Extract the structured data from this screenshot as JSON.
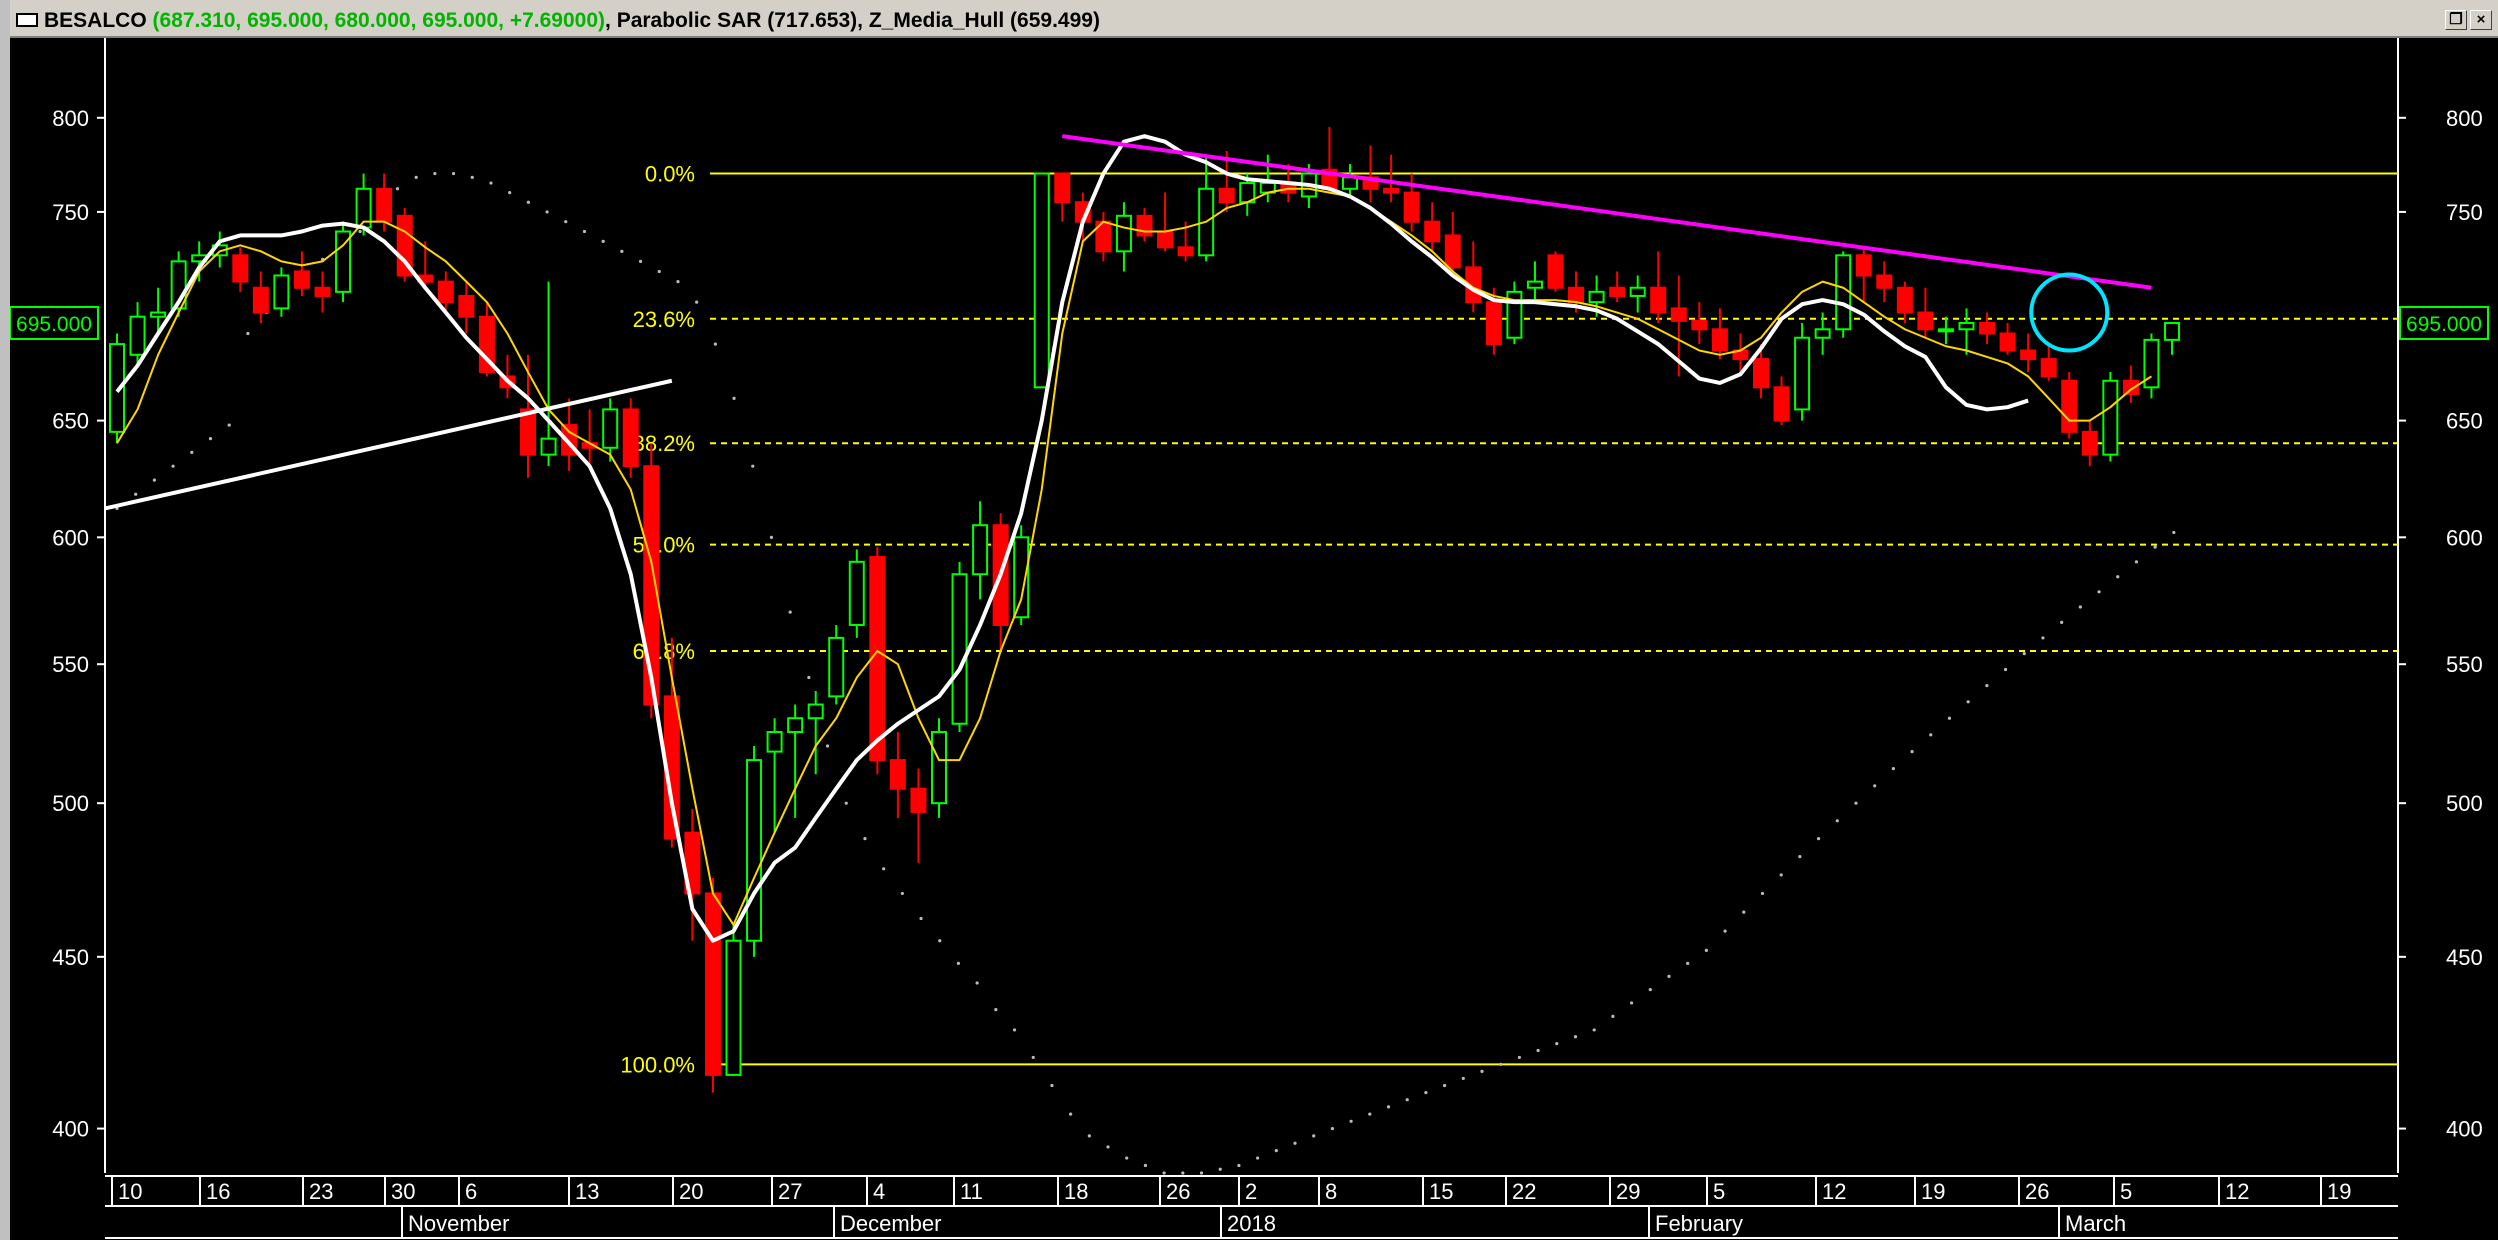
{
  "window": {
    "symbol": "BESALCO",
    "ohlc": "(687.310, 695.000, 680.000, 695.000, +7.69000)",
    "indicator1": "Parabolic SAR",
    "indicator1_value": "(717.653)",
    "indicator2": "Z_Media_Hull",
    "indicator2_value": "(659.499)",
    "restore_button": "❐",
    "close_button": "×"
  },
  "colors": {
    "background": "#000000",
    "up_candle": "#00ff00",
    "down_candle": "#ff0000",
    "hull_ma": "#ffffff",
    "fast_ma": "#ffd700",
    "fibonacci": "#ffff00",
    "resistance_line": "#ff00ff",
    "support_line": "#ffffff",
    "highlight_circle": "#00e5ff",
    "sar_dots": "#bbbbbb",
    "last_price_label": "#00ff00"
  },
  "chart_data": {
    "type": "candlestick",
    "y_scale": "log",
    "ylim": [
      388,
      845
    ],
    "y_ticks": [
      400,
      450,
      500,
      550,
      600,
      650,
      750,
      800
    ],
    "last_price_label": "695.000",
    "x_day_labels": [
      "10",
      "16",
      "23",
      "30",
      "6",
      "13",
      "20",
      "27",
      "4",
      "11",
      "18",
      "26",
      "2",
      "8",
      "15",
      "22",
      "29",
      "5",
      "12",
      "19",
      "26",
      "5",
      "12",
      "19"
    ],
    "x_month_labels": [
      "November",
      "December",
      "2018",
      "February",
      "March"
    ],
    "candles": [
      {
        "o": 645,
        "h": 690,
        "l": 640,
        "c": 685
      },
      {
        "o": 680,
        "h": 705,
        "l": 675,
        "c": 698
      },
      {
        "o": 698,
        "h": 712,
        "l": 690,
        "c": 700
      },
      {
        "o": 702,
        "h": 730,
        "l": 698,
        "c": 725
      },
      {
        "o": 725,
        "h": 735,
        "l": 715,
        "c": 728
      },
      {
        "o": 728,
        "h": 740,
        "l": 722,
        "c": 733
      },
      {
        "o": 728,
        "h": 732,
        "l": 710,
        "c": 715
      },
      {
        "o": 712,
        "h": 720,
        "l": 695,
        "c": 700
      },
      {
        "o": 702,
        "h": 722,
        "l": 698,
        "c": 718
      },
      {
        "o": 720,
        "h": 730,
        "l": 708,
        "c": 712
      },
      {
        "o": 712,
        "h": 720,
        "l": 700,
        "c": 708
      },
      {
        "o": 710,
        "h": 745,
        "l": 705,
        "c": 740
      },
      {
        "o": 742,
        "h": 770,
        "l": 738,
        "c": 762
      },
      {
        "o": 762,
        "h": 770,
        "l": 740,
        "c": 745
      },
      {
        "o": 748,
        "h": 752,
        "l": 715,
        "c": 718
      },
      {
        "o": 718,
        "h": 735,
        "l": 712,
        "c": 715
      },
      {
        "o": 715,
        "h": 720,
        "l": 700,
        "c": 705
      },
      {
        "o": 708,
        "h": 715,
        "l": 690,
        "c": 698
      },
      {
        "o": 698,
        "h": 705,
        "l": 670,
        "c": 672
      },
      {
        "o": 670,
        "h": 680,
        "l": 660,
        "c": 665
      },
      {
        "o": 655,
        "h": 680,
        "l": 625,
        "c": 635
      },
      {
        "o": 635,
        "h": 715,
        "l": 630,
        "c": 642
      },
      {
        "o": 648,
        "h": 660,
        "l": 628,
        "c": 635
      },
      {
        "o": 640,
        "h": 655,
        "l": 630,
        "c": 638
      },
      {
        "o": 638,
        "h": 660,
        "l": 632,
        "c": 655
      },
      {
        "o": 655,
        "h": 660,
        "l": 625,
        "c": 630
      },
      {
        "o": 630,
        "h": 640,
        "l": 530,
        "c": 535
      },
      {
        "o": 538,
        "h": 560,
        "l": 485,
        "c": 488
      },
      {
        "o": 490,
        "h": 498,
        "l": 455,
        "c": 470
      },
      {
        "o": 470,
        "h": 475,
        "l": 410,
        "c": 415
      },
      {
        "o": 415,
        "h": 460,
        "l": 415,
        "c": 455
      },
      {
        "o": 455,
        "h": 520,
        "l": 450,
        "c": 515
      },
      {
        "o": 518,
        "h": 530,
        "l": 490,
        "c": 525
      },
      {
        "o": 525,
        "h": 535,
        "l": 495,
        "c": 530
      },
      {
        "o": 530,
        "h": 540,
        "l": 510,
        "c": 535
      },
      {
        "o": 538,
        "h": 565,
        "l": 535,
        "c": 560
      },
      {
        "o": 565,
        "h": 595,
        "l": 560,
        "c": 590
      },
      {
        "o": 592,
        "h": 596,
        "l": 510,
        "c": 515
      },
      {
        "o": 515,
        "h": 525,
        "l": 495,
        "c": 505
      },
      {
        "o": 505,
        "h": 512,
        "l": 480,
        "c": 497
      },
      {
        "o": 500,
        "h": 530,
        "l": 495,
        "c": 525
      },
      {
        "o": 528,
        "h": 590,
        "l": 525,
        "c": 585
      },
      {
        "o": 585,
        "h": 615,
        "l": 575,
        "c": 605
      },
      {
        "o": 605,
        "h": 610,
        "l": 555,
        "c": 565
      },
      {
        "o": 568,
        "h": 605,
        "l": 565,
        "c": 600
      },
      {
        "o": 665,
        "h": 770,
        "l": 665,
        "c": 770
      },
      {
        "o": 770,
        "h": 770,
        "l": 745,
        "c": 755
      },
      {
        "o": 755,
        "h": 760,
        "l": 735,
        "c": 745
      },
      {
        "o": 745,
        "h": 750,
        "l": 725,
        "c": 730
      },
      {
        "o": 730,
        "h": 755,
        "l": 720,
        "c": 748
      },
      {
        "o": 748,
        "h": 752,
        "l": 735,
        "c": 738
      },
      {
        "o": 740,
        "h": 760,
        "l": 730,
        "c": 732
      },
      {
        "o": 732,
        "h": 745,
        "l": 725,
        "c": 728
      },
      {
        "o": 728,
        "h": 780,
        "l": 725,
        "c": 762
      },
      {
        "o": 762,
        "h": 782,
        "l": 750,
        "c": 755
      },
      {
        "o": 755,
        "h": 770,
        "l": 748,
        "c": 765
      },
      {
        "o": 760,
        "h": 780,
        "l": 755,
        "c": 765
      },
      {
        "o": 765,
        "h": 775,
        "l": 755,
        "c": 760
      },
      {
        "o": 758,
        "h": 775,
        "l": 752,
        "c": 770
      },
      {
        "o": 772,
        "h": 795,
        "l": 760,
        "c": 762
      },
      {
        "o": 762,
        "h": 775,
        "l": 758,
        "c": 768
      },
      {
        "o": 768,
        "h": 785,
        "l": 755,
        "c": 762
      },
      {
        "o": 762,
        "h": 780,
        "l": 755,
        "c": 760
      },
      {
        "o": 760,
        "h": 770,
        "l": 740,
        "c": 745
      },
      {
        "o": 745,
        "h": 755,
        "l": 730,
        "c": 735
      },
      {
        "o": 738,
        "h": 750,
        "l": 720,
        "c": 722
      },
      {
        "o": 722,
        "h": 735,
        "l": 700,
        "c": 705
      },
      {
        "o": 705,
        "h": 712,
        "l": 680,
        "c": 685
      },
      {
        "o": 688,
        "h": 715,
        "l": 685,
        "c": 710
      },
      {
        "o": 712,
        "h": 725,
        "l": 705,
        "c": 715
      },
      {
        "o": 728,
        "h": 730,
        "l": 710,
        "c": 712
      },
      {
        "o": 712,
        "h": 720,
        "l": 700,
        "c": 705
      },
      {
        "o": 705,
        "h": 718,
        "l": 698,
        "c": 710
      },
      {
        "o": 712,
        "h": 720,
        "l": 705,
        "c": 708
      },
      {
        "o": 708,
        "h": 718,
        "l": 700,
        "c": 712
      },
      {
        "o": 712,
        "h": 730,
        "l": 695,
        "c": 700
      },
      {
        "o": 702,
        "h": 718,
        "l": 670,
        "c": 696
      },
      {
        "o": 696,
        "h": 705,
        "l": 685,
        "c": 692
      },
      {
        "o": 692,
        "h": 702,
        "l": 678,
        "c": 682
      },
      {
        "o": 682,
        "h": 690,
        "l": 672,
        "c": 678
      },
      {
        "o": 678,
        "h": 685,
        "l": 660,
        "c": 665
      },
      {
        "o": 665,
        "h": 670,
        "l": 648,
        "c": 650
      },
      {
        "o": 655,
        "h": 695,
        "l": 650,
        "c": 688
      },
      {
        "o": 688,
        "h": 700,
        "l": 680,
        "c": 692
      },
      {
        "o": 692,
        "h": 730,
        "l": 688,
        "c": 728
      },
      {
        "o": 728,
        "h": 732,
        "l": 705,
        "c": 718
      },
      {
        "o": 718,
        "h": 725,
        "l": 705,
        "c": 712
      },
      {
        "o": 712,
        "h": 715,
        "l": 695,
        "c": 700
      },
      {
        "o": 700,
        "h": 712,
        "l": 688,
        "c": 692
      },
      {
        "o": 692,
        "h": 698,
        "l": 685,
        "c": 692
      },
      {
        "o": 692,
        "h": 702,
        "l": 680,
        "c": 695
      },
      {
        "o": 695,
        "h": 700,
        "l": 685,
        "c": 690
      },
      {
        "o": 690,
        "h": 695,
        "l": 680,
        "c": 682
      },
      {
        "o": 682,
        "h": 690,
        "l": 672,
        "c": 678
      },
      {
        "o": 678,
        "h": 685,
        "l": 668,
        "c": 670
      },
      {
        "o": 668,
        "h": 672,
        "l": 642,
        "c": 645
      },
      {
        "o": 645,
        "h": 650,
        "l": 630,
        "c": 635
      },
      {
        "o": 635,
        "h": 672,
        "l": 632,
        "c": 668
      },
      {
        "o": 668,
        "h": 675,
        "l": 658,
        "c": 662
      },
      {
        "o": 665,
        "h": 690,
        "l": 660,
        "c": 687
      },
      {
        "o": 687,
        "h": 695,
        "l": 680,
        "c": 695
      }
    ],
    "hull_ma": [
      663,
      675,
      690,
      705,
      722,
      735,
      738,
      738,
      738,
      740,
      743,
      744,
      742,
      735,
      725,
      712,
      700,
      688,
      678,
      668,
      660,
      650,
      640,
      630,
      612,
      585,
      545,
      500,
      465,
      455,
      458,
      470,
      480,
      485,
      495,
      505,
      515,
      522,
      528,
      533,
      538,
      548,
      565,
      585,
      610,
      650,
      705,
      745,
      770,
      787,
      790,
      787,
      780,
      776,
      770,
      767,
      766,
      765,
      764,
      762,
      758,
      752,
      744,
      735,
      727,
      718,
      711,
      706,
      705,
      705,
      704,
      703,
      701,
      697,
      691,
      685,
      677,
      669,
      667,
      671,
      683,
      697,
      704,
      706,
      704,
      699,
      691,
      684,
      679,
      665,
      657,
      655,
      656,
      659
    ],
    "fast_ma": [
      640,
      655,
      680,
      700,
      720,
      730,
      733,
      730,
      725,
      723,
      725,
      733,
      745,
      745,
      740,
      732,
      725,
      715,
      705,
      690,
      672,
      655,
      645,
      640,
      635,
      620,
      590,
      545,
      505,
      470,
      460,
      475,
      490,
      505,
      520,
      530,
      545,
      555,
      550,
      530,
      515,
      515,
      530,
      555,
      575,
      620,
      690,
      735,
      745,
      742,
      740,
      740,
      742,
      745,
      752,
      755,
      760,
      762,
      762,
      760,
      758,
      752,
      745,
      738,
      730,
      720,
      712,
      708,
      706,
      706,
      706,
      705,
      703,
      700,
      697,
      692,
      687,
      682,
      680,
      682,
      688,
      700,
      710,
      715,
      712,
      705,
      698,
      692,
      688,
      684,
      682,
      679,
      676,
      670,
      660,
      650,
      650,
      656,
      664,
      670
    ],
    "sar": [
      612,
      618,
      624,
      630,
      636,
      642,
      648,
      690,
      700,
      710,
      718,
      726,
      735,
      740,
      755,
      762,
      768,
      770,
      770,
      768,
      765,
      760,
      755,
      750,
      745,
      740,
      735,
      730,
      725,
      720,
      715,
      705,
      685,
      660,
      630,
      600,
      570,
      545,
      520,
      500,
      488,
      478,
      470,
      462,
      455,
      448,
      442,
      434,
      428,
      420,
      412,
      404,
      398,
      395,
      392,
      390,
      388,
      388,
      388,
      389,
      390,
      392,
      394,
      396,
      398,
      400,
      402,
      404,
      406,
      408,
      410,
      412,
      414,
      416,
      418,
      420,
      422,
      424,
      426,
      428,
      432,
      436,
      440,
      444,
      448,
      452,
      458,
      464,
      470,
      476,
      482,
      488,
      494,
      500,
      506,
      512,
      518,
      524,
      530,
      536,
      542,
      548,
      554,
      560,
      566,
      572,
      578,
      584,
      590,
      596,
      602
    ],
    "fibonacci": [
      {
        "label": "0.0%",
        "value": 770
      },
      {
        "label": "23.6%",
        "value": 697
      },
      {
        "label": "38.2%",
        "value": 640
      },
      {
        "label": "50.0%",
        "value": 597
      },
      {
        "label": "61.8%",
        "value": 555
      },
      {
        "label": "100.0%",
        "value": 418
      }
    ],
    "trendlines": [
      {
        "name": "support",
        "x0": 0,
        "y0": 612,
        "x1": 27,
        "y1": 668
      },
      {
        "name": "resistance",
        "x0": 46,
        "y0": 790,
        "x1": 99,
        "y1": 712
      }
    ],
    "highlight": {
      "x": 95,
      "y": 700
    }
  }
}
